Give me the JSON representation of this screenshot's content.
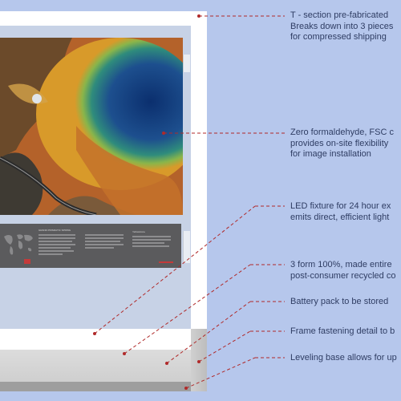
{
  "callouts": [
    {
      "id": "t-section",
      "text": "T - section pre-fabricated\nBreaks down into 3 pieces\nfor compressed shipping"
    },
    {
      "id": "zero-formaldehyde",
      "text": "Zero formaldehyde, FSC c\nprovides on-site flexibility\nfor image installation"
    },
    {
      "id": "led-fixture",
      "text": "LED fixture for 24 hour ex\nemits direct, efficient light"
    },
    {
      "id": "form-recycled",
      "text": "3 form 100%, made entire\npost-consumer recycled co"
    },
    {
      "id": "battery-pack",
      "text": "Battery pack to be stored"
    },
    {
      "id": "frame-fastening",
      "text": "Frame fastening detail to b"
    },
    {
      "id": "leveling-base",
      "text": "Leveling base allows for up"
    }
  ],
  "info_panel": {
    "title": "GRAND PRISMATIC SPRING",
    "heading_right": "Yellowstone"
  },
  "colors": {
    "background": "#b6c7ec",
    "leader_line": "#b02a2a",
    "label_text": "#2f3d63"
  }
}
